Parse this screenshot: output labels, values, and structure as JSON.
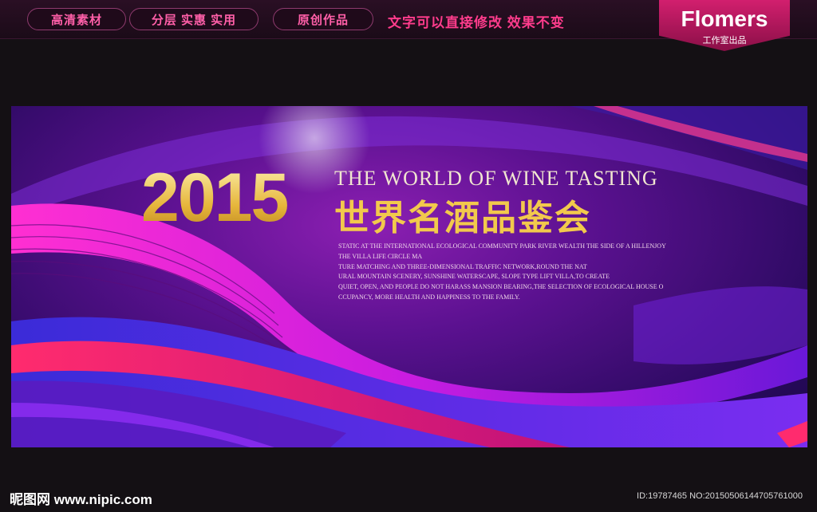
{
  "header": {
    "pills": [
      "高清素材",
      "分层 实惠 实用",
      "原创作品"
    ],
    "slogan": "文字可以直接修改  效果不变",
    "logo_title": "Flomers",
    "logo_subtitle": "工作室出品"
  },
  "banner": {
    "year": "2015",
    "english_title": "THE WORLD OF WINE TASTING",
    "chinese_title": "世界名酒品鉴会",
    "description_lines": [
      "STATIC AT THE INTERNATIONAL ECOLOGICAL COMMUNITY PARK RIVER WEALTH THE SIDE OF A HILLENJOY",
      "THE VILLA LIFE CIRCLE MA",
      "TURE MATCHING AND THREE-DIMENSIONAL TRAFFIC NETWORK,ROUND THE NAT",
      "URAL MOUNTAIN SCENERY, SUNSHINE WATERSCAPE, SLOPE TYPE LIFT VILLA,TO CREATE",
      "QUIET, OPEN, AND PEOPLE DO NOT HARASS MANSION BEARING,THE SELECTION OF ECOLOGICAL HOUSE O",
      "CCUPANCY, MORE HEALTH AND HAPPINESS TO THE FAMILY."
    ]
  },
  "footer": {
    "watermark": "昵图网 www.nipic.com",
    "image_id": "ID:19787465 NO:20150506144705761000"
  },
  "colors": {
    "accent": "#ff3c8c",
    "gold": "#f2c94c",
    "banner_purple": "#5b1190"
  }
}
